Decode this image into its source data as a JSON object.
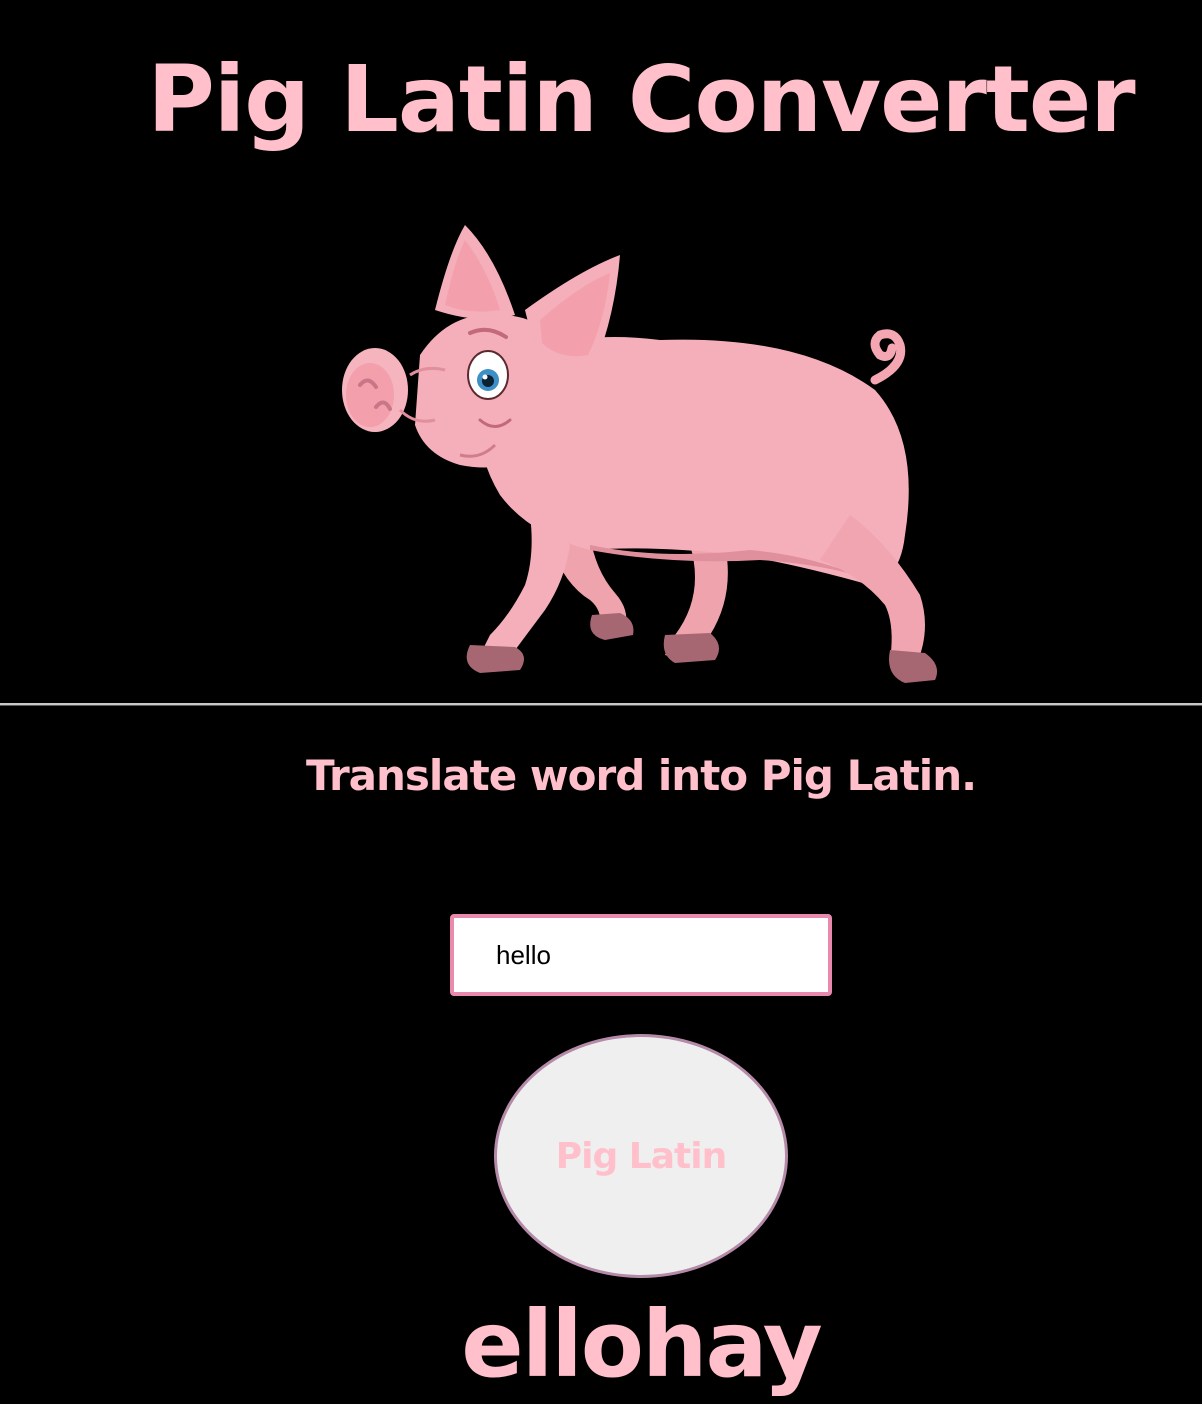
{
  "header": {
    "title": "Pig Latin Converter"
  },
  "hero": {
    "image_icon": "cartoon-pig-illustration"
  },
  "main": {
    "instruction": "Translate word into Pig Latin.",
    "input": {
      "value": "hello",
      "placeholder": ""
    },
    "convert_button_label": "Pig Latin",
    "result": "ellohay"
  },
  "colors": {
    "background": "#000000",
    "accent_pink": "#ffc0cb",
    "input_border": "#e889ad",
    "button_bg": "#efefef",
    "button_border": "#b58aa8"
  }
}
